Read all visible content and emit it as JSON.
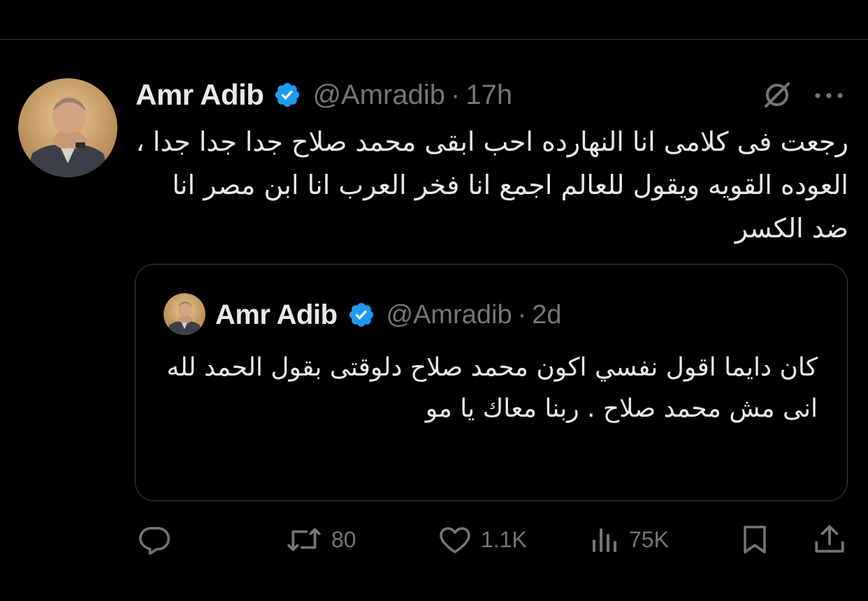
{
  "tweet": {
    "author_name": "Amr Adib",
    "handle": "@Amradib",
    "separator": "·",
    "time": "17h",
    "text": "رجعت فى كلامى انا النهارده احب ابقى محمد صلاح جدا جدا جدا ، العوده القويه ويقول للعالم اجمع انا فخر العرب انا ابن مصر انا ضد الكسر"
  },
  "quoted_tweet": {
    "author_name": "Amr Adib",
    "handle": "@Amradib",
    "separator": "·",
    "time": "2d",
    "text": "كان دايما اقول نفسي اكون محمد صلاح دلوقتى بقول الحمد لله انى مش محمد صلاح . ربنا معاك يا مو"
  },
  "actions": {
    "reply_count": "",
    "retweet_count": "80",
    "like_count": "1.1K",
    "view_count": "75K"
  },
  "colors": {
    "background": "#000000",
    "text_primary": "#e7e9ea",
    "text_secondary": "#71767b",
    "verified_badge": "#1d9bf0",
    "border": "#2f3336"
  },
  "icons": {
    "verified": "verified-badge-icon",
    "grok": "grok-icon",
    "more": "more-options-icon",
    "reply": "reply-icon",
    "retweet": "retweet-icon",
    "like": "like-icon",
    "views": "views-icon",
    "bookmark": "bookmark-icon",
    "share": "share-icon"
  }
}
